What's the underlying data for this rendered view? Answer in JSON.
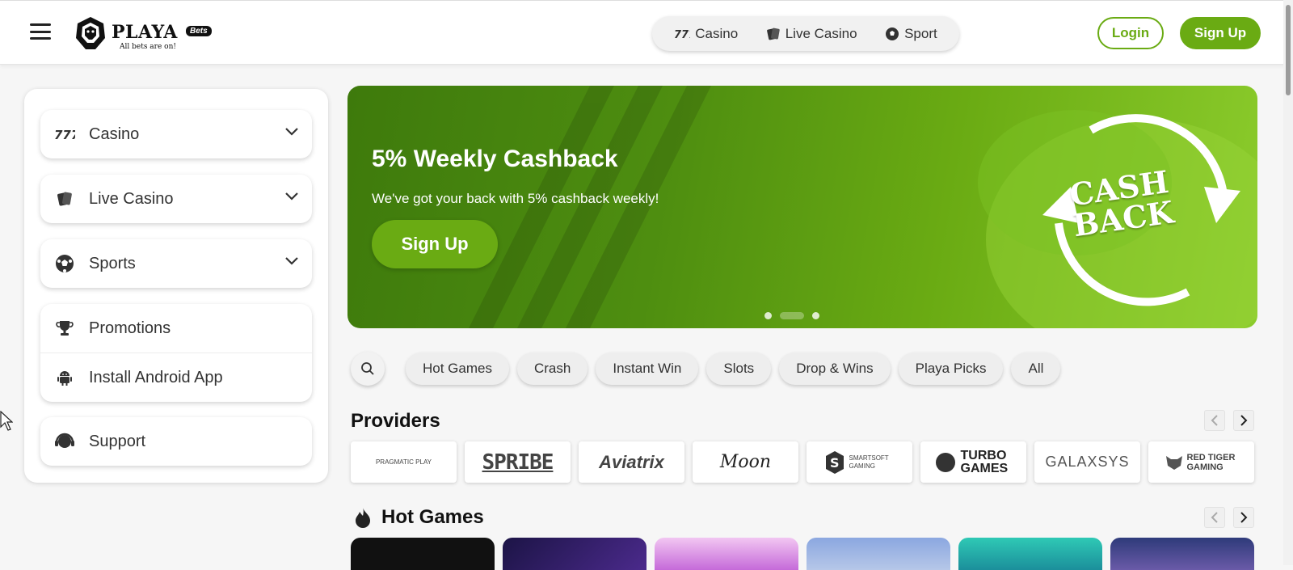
{
  "header": {
    "logo_text": "PLAYA",
    "logo_badge": "Bets",
    "logo_tagline": "All bets are on!",
    "nav": [
      {
        "label": "Casino",
        "icon": "slot-777-icon"
      },
      {
        "label": "Live Casino",
        "icon": "cards-icon"
      },
      {
        "label": "Sport",
        "icon": "soccer-ball-icon"
      }
    ],
    "login_label": "Login",
    "signup_label": "Sign Up"
  },
  "sidebar": {
    "groups": [
      {
        "label": "Casino",
        "icon": "slot-777-icon",
        "expandable": true
      },
      {
        "label": "Live Casino",
        "icon": "cards-icon",
        "expandable": true
      },
      {
        "label": "Sports",
        "icon": "soccer-ball-icon",
        "expandable": true
      }
    ],
    "links": [
      {
        "label": "Promotions",
        "icon": "trophy-icon"
      },
      {
        "label": "Install Android App",
        "icon": "android-icon"
      }
    ],
    "support": {
      "label": "Support",
      "icon": "headset-icon"
    }
  },
  "banner": {
    "title": "5% Weekly Cashback",
    "subtitle": "We've got your back with 5% cashback weekly!",
    "button_label": "Sign Up",
    "art_line1": "CASH",
    "art_line2": "BACK",
    "slides": 3,
    "active_slide": 2
  },
  "filters": [
    "Hot Games",
    "Crash",
    "Instant Win",
    "Slots",
    "Drop & Wins",
    "Playa Picks",
    "All"
  ],
  "providers": {
    "title": "Providers",
    "items": [
      "PRAGMATIC PLAY",
      "SPRIBE",
      "Aviatrix",
      "Moon",
      "SMARTSOFT GAMING",
      "TURBO GAMES",
      "GALAXSYS",
      "RED TIGER GAMING"
    ]
  },
  "hot_games": {
    "title": "Hot Games",
    "tile_colors": [
      "#111111",
      "#2a1b5c",
      "#d9a8e8",
      "#7c9bd6",
      "#24b7b0",
      "#3b3f7a"
    ]
  },
  "colors": {
    "accent": "#6aab13",
    "banner_dark": "#3e7a0c",
    "banner_light": "#8ccc2c"
  }
}
